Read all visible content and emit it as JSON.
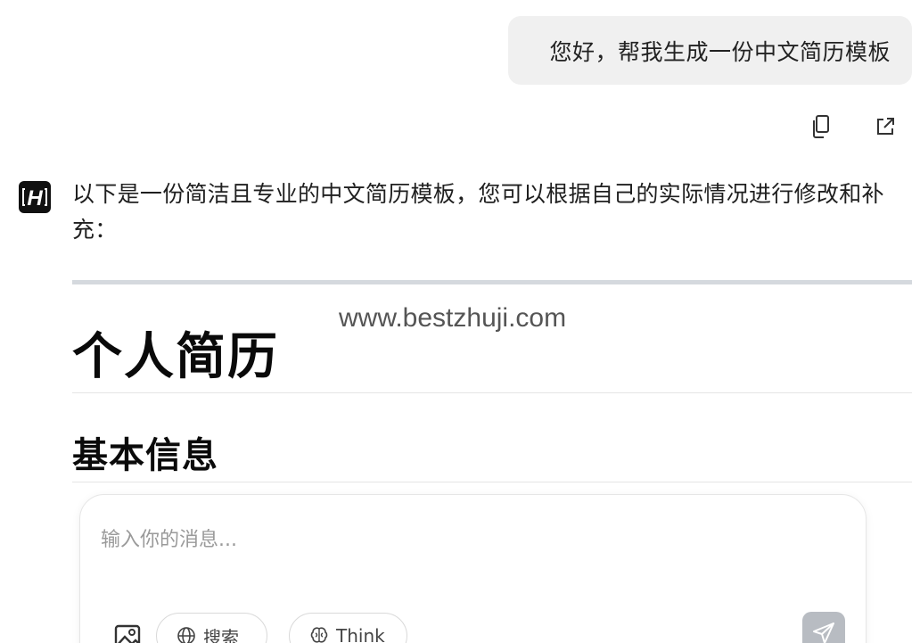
{
  "user_message": "您好，帮我生成一份中文简历模板",
  "message_actions": {
    "copy_icon": "copy-icon",
    "open_icon": "external-link-icon"
  },
  "bot": {
    "avatar_letter": "H",
    "intro": "以下是一份简洁且专业的中文简历模板，您可以根据自己的实际情况进行修改和补充："
  },
  "content": {
    "h1": "个人简历",
    "h2": "基本信息"
  },
  "watermark": "www.bestzhuji.com",
  "composer": {
    "placeholder": "输入你的消息...",
    "search_label": "搜索",
    "think_label": "Think",
    "image_icon": "image-icon",
    "globe_icon": "globe-icon",
    "brain_icon": "brain-icon",
    "send_icon": "send-icon"
  },
  "colors": {
    "user_bubble_bg": "#f0f0f0",
    "divider": "#d5d9de",
    "send_bg": "#b8bcc2",
    "avatar_bg": "#111111"
  }
}
